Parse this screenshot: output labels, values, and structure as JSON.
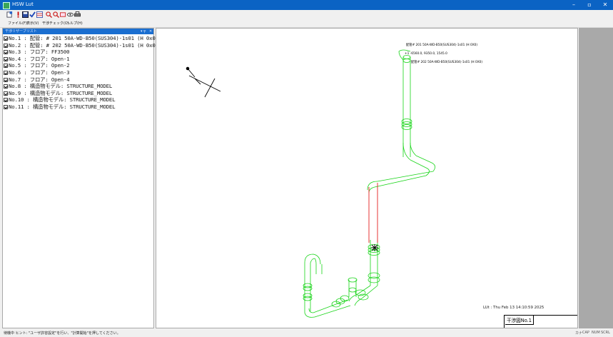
{
  "window": {
    "title": "HSW Lut"
  },
  "toolbar": {
    "icons": [
      "new-icon",
      "exclamation-icon",
      "save-icon",
      "check-icon",
      "table-icon",
      "zoom-in-icon",
      "zoom-out-icon",
      "zoom-fit-icon",
      "eye-icon",
      "print-icon"
    ]
  },
  "menu": {
    "items": [
      "ファイル(F)",
      "表示(V)",
      "干渉チェック(C)",
      "ヘルプ(H)"
    ]
  },
  "panel": {
    "title": "干渉リザーブリスト"
  },
  "tree": {
    "items": [
      "No.1 : 配管: # 201 50A-WD-B50(SUS304)-1s01 (H 0x0)",
      "No.2 : 配管: # 202 50A-WD-B50(SUS304)-1s01 (H 0x0)",
      "No.3 : フロア: FF3500",
      "No.4 : フロア: Open-1",
      "No.5 : フロア: Open-2",
      "No.6 : フロア: Open-3",
      "No.7 : フロア: Open-4",
      "No.8 : 構造物モデル: STRUCTURE_MODEL",
      "No.9 : 構造物モデル: STRUCTURE_MODEL",
      "No.10 : 構造物モデル: STRUCTURE_MODEL",
      "No.11 : 構造物モデル: STRUCTURE_MODEL"
    ]
  },
  "canvas": {
    "label_top": "配管# 201 50A-WD-B50(SUS304)-1s01 (H 0X0)",
    "label_coord": "+1  -6560.0, 9350.0, 1545.0",
    "label_second": "配管# 202 50A-WD-B50(SUS304)-1s01 (H 0X0)",
    "stamp": "LUt : Thu Feb 13 14:10:59 2025",
    "sheet_label": "干渉図No.1"
  },
  "status": {
    "message": "待機中  ヒント: \"ユーザ許容設定\"を行い、\"計算開始\"を押してください。",
    "indicators": [
      "カナ",
      "CAP",
      "NUM",
      "SCRL"
    ]
  },
  "colors": {
    "titlebar": "#0b63c4",
    "pipe": "#17d417",
    "interference": "#e52020"
  }
}
